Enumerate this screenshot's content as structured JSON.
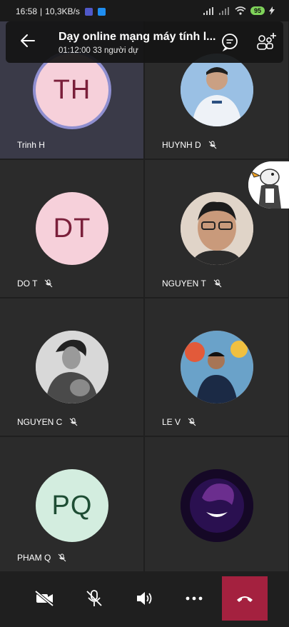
{
  "status": {
    "time": "16:58",
    "net": "10,3KB/s",
    "battery": "95"
  },
  "header": {
    "title": "Dạy online mạng máy tính l...",
    "subtitle": "01:12:00 33 người dự"
  },
  "participants": [
    {
      "initials": "TH",
      "name": "Trinh H",
      "avatar_bg": "#f6d0da",
      "avatar_fg": "#7a1f3a"
    },
    {
      "initials": "",
      "name": "HUYNH D",
      "avatar_bg": "#9ac0e4"
    },
    {
      "initials": "DT",
      "name": "DO T",
      "avatar_bg": "#f6d0da",
      "avatar_fg": "#7a1f3a"
    },
    {
      "initials": "",
      "name": "NGUYEN T",
      "avatar_bg": "#d9c6b5"
    },
    {
      "initials": "",
      "name": "NGUYEN C",
      "avatar_bg": "#bdbdbd"
    },
    {
      "initials": "",
      "name": "LE V",
      "avatar_bg": "#c7633d"
    },
    {
      "initials": "PQ",
      "name": "PHAM Q",
      "avatar_bg": "#d3eddf",
      "avatar_fg": "#1e4d34"
    },
    {
      "initials": "",
      "name": "",
      "avatar_bg": "#1b0b33"
    }
  ],
  "colors": {
    "end_call": "#a4213f",
    "header_bg": "#141414"
  }
}
